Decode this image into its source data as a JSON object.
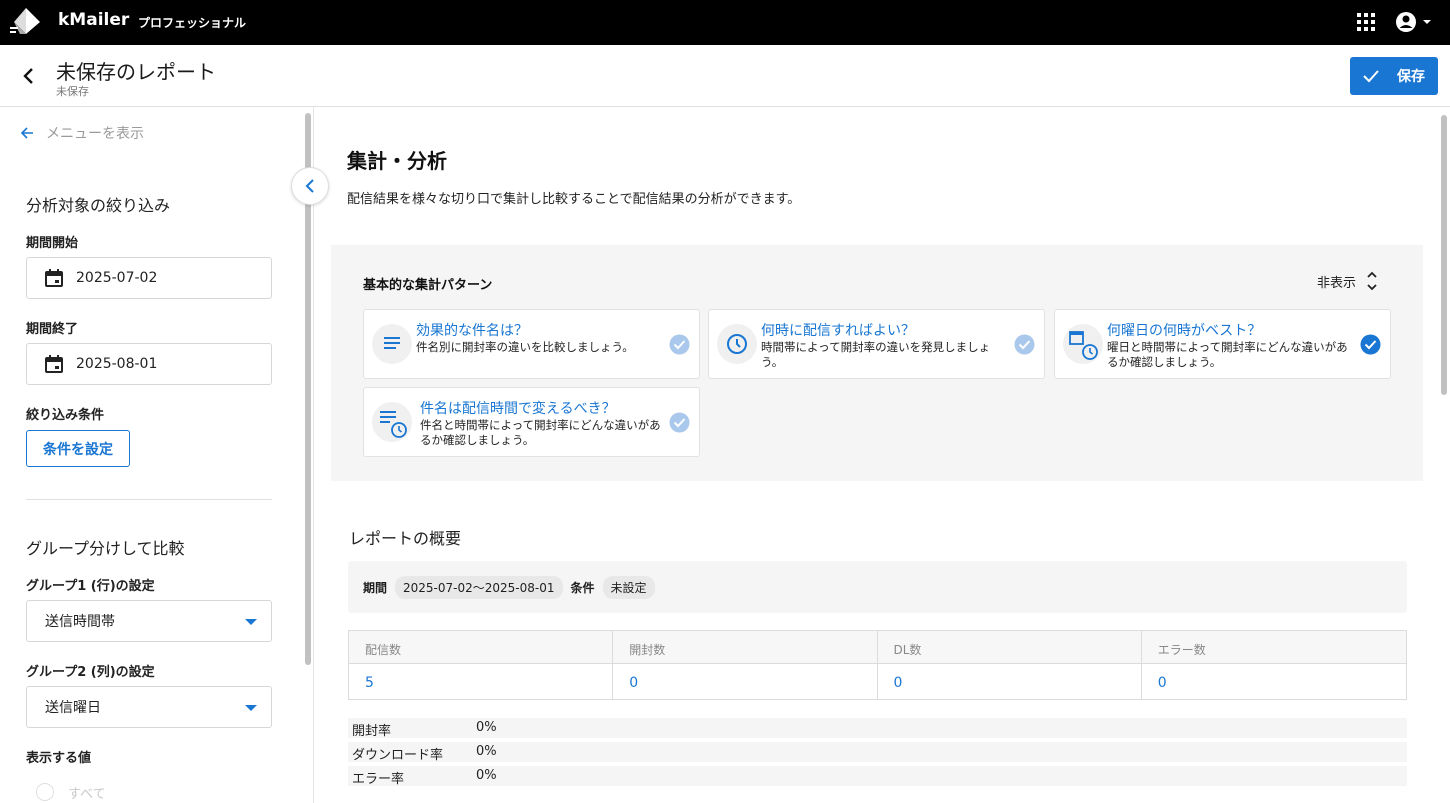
{
  "app": {
    "brand": "kMailer",
    "edition": "プロフェッショナル"
  },
  "header": {
    "title": "未保存のレポート",
    "subtitle": "未保存",
    "save_label": "保存"
  },
  "sidebar": {
    "menu_link": "メニューを表示",
    "filter_heading": "分析対象の絞り込み",
    "period_start_label": "期間開始",
    "period_start_value": "2025-07-02",
    "period_end_label": "期間終了",
    "period_end_value": "2025-08-01",
    "condition_label": "絞り込み条件",
    "condition_button": "条件を設定",
    "group_heading": "グループ分けして比較",
    "group1_label": "グループ1 (行)の設定",
    "group1_value": "送信時間帯",
    "group2_label": "グループ2 (列)の設定",
    "group2_value": "送信曜日",
    "display_label": "表示する値",
    "display_option": "すべて"
  },
  "main": {
    "title": "集計・分析",
    "description": "配信結果を様々な切り口で集計し比較することで配信結果の分析ができます。",
    "patterns": {
      "title": "基本的な集計パターン",
      "toggle": "非表示",
      "cards": [
        {
          "title": "効果的な件名は？",
          "desc": "件名別に開封率の違いを比較しましょう。",
          "icon": "list-icon",
          "checked": false
        },
        {
          "title": "何時に配信すればよい？",
          "desc": "時間帯によって開封率の違いを発見しましょう。",
          "icon": "clock-icon",
          "checked": false
        },
        {
          "title": "何曜日の何時がベスト？",
          "desc": "曜日と時間帯によって開封率にどんな違いがあるか確認しましょう。",
          "icon": "calendar-clock-icon",
          "checked": true
        },
        {
          "title": "件名は配信時間で変えるべき？",
          "desc": "件名と時間帯によって開封率にどんな違いがあるか確認しましょう。",
          "icon": "list-clock-icon",
          "checked": false
        }
      ]
    },
    "overview": {
      "title": "レポートの概要",
      "period_key": "期間",
      "period_value": "2025-07-02〜2025-08-01",
      "condition_key": "条件",
      "condition_value": "未設定",
      "stats": [
        {
          "label": "配信数",
          "value": "5"
        },
        {
          "label": "開封数",
          "value": "0"
        },
        {
          "label": "DL数",
          "value": "0"
        },
        {
          "label": "エラー数",
          "value": "0"
        }
      ],
      "rates": [
        {
          "label": "開封率",
          "value": "0%"
        },
        {
          "label": "ダウンロード率",
          "value": "0%"
        },
        {
          "label": "エラー率",
          "value": "0%"
        }
      ]
    }
  },
  "colors": {
    "primary": "#1976d2",
    "topbar": "#000000",
    "check_muted": "#a9c8ec"
  }
}
